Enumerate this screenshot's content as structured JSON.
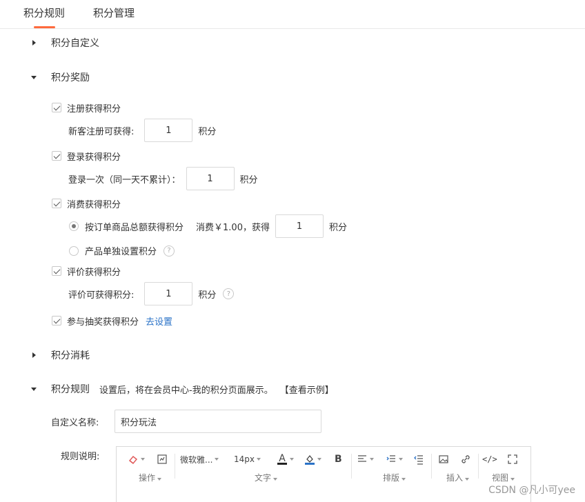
{
  "tabs": [
    {
      "label": "积分规则",
      "active": true
    },
    {
      "label": "积分管理",
      "active": false
    }
  ],
  "accent_color": "#ff6a3d",
  "link_color": "#2a72c7",
  "sections": {
    "custom": {
      "title": "积分自定义",
      "expanded": false
    },
    "rewards": {
      "title": "积分奖励",
      "expanded": true
    },
    "consume": {
      "title": "积分消耗",
      "expanded": false
    },
    "rules": {
      "title": "积分规则",
      "expanded": true,
      "desc": "设置后，将在会员中心-我的积分页面展示。",
      "example_link": "【查看示例】"
    }
  },
  "rewards": {
    "register": {
      "label": "注册获得积分",
      "checked": true,
      "field_label": "新客注册可获得:",
      "value": "1",
      "unit": "积分"
    },
    "login": {
      "label": "登录获得积分",
      "checked": true,
      "field_label": "登录一次（同一天不累计）：",
      "value": "1",
      "unit": "积分"
    },
    "consume": {
      "label": "消费获得积分",
      "checked": true,
      "option_order": {
        "label": "按订单商品总额获得积分",
        "selected": true,
        "prefix": "消费￥1.00，获得",
        "value": "1",
        "unit": "积分"
      },
      "option_product": {
        "label": "产品单独设置积分",
        "selected": false
      }
    },
    "review": {
      "label": "评价获得积分",
      "checked": true,
      "field_label": "评价可获得积分:",
      "value": "1",
      "unit": "积分"
    },
    "lottery": {
      "label": "参与抽奖获得积分",
      "checked": true,
      "link": "去设置"
    }
  },
  "help_glyph": "?",
  "rules_form": {
    "name_label": "自定义名称:",
    "name_value": "积分玩法",
    "desc_label": "规则说明:"
  },
  "editor_toolbar": {
    "groups": {
      "ops": "操作",
      "text": "文字",
      "layout": "排版",
      "insert": "插入",
      "view": "视图"
    },
    "font_family": "微软雅...",
    "font_size": "14px",
    "font_color_glyph": "A",
    "bold_glyph": "B",
    "code_glyph": "</>",
    "icons": [
      "eraser-icon",
      "format-painter-icon",
      "font-color-icon",
      "highlight-color-icon",
      "bold-icon",
      "align-icon",
      "indent-icon",
      "outdent-icon",
      "image-icon",
      "link-icon",
      "code-icon",
      "fullscreen-icon"
    ]
  },
  "watermark": "CSDN @凡小可yee"
}
